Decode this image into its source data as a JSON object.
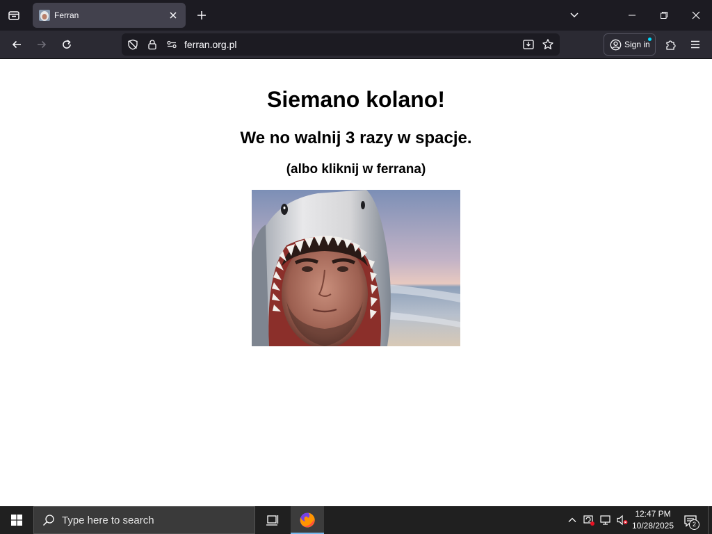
{
  "browser": {
    "tab": {
      "title": "Ferran"
    },
    "url": "ferran.org.pl",
    "signin_label": "Sign in"
  },
  "page": {
    "heading": "Siemano kolano!",
    "subheading": "We no walnij 3 razy w spacje.",
    "hint": "(albo kliknij w ferrana)"
  },
  "taskbar": {
    "search_placeholder": "Type here to search",
    "time": "12:47 PM",
    "date": "10/28/2025",
    "notifications_count": "2"
  },
  "colors": {
    "tabstrip": "#1c1b22",
    "toolbar": "#2b2a33",
    "taskbar": "#202020",
    "accent": "#00ddff"
  }
}
